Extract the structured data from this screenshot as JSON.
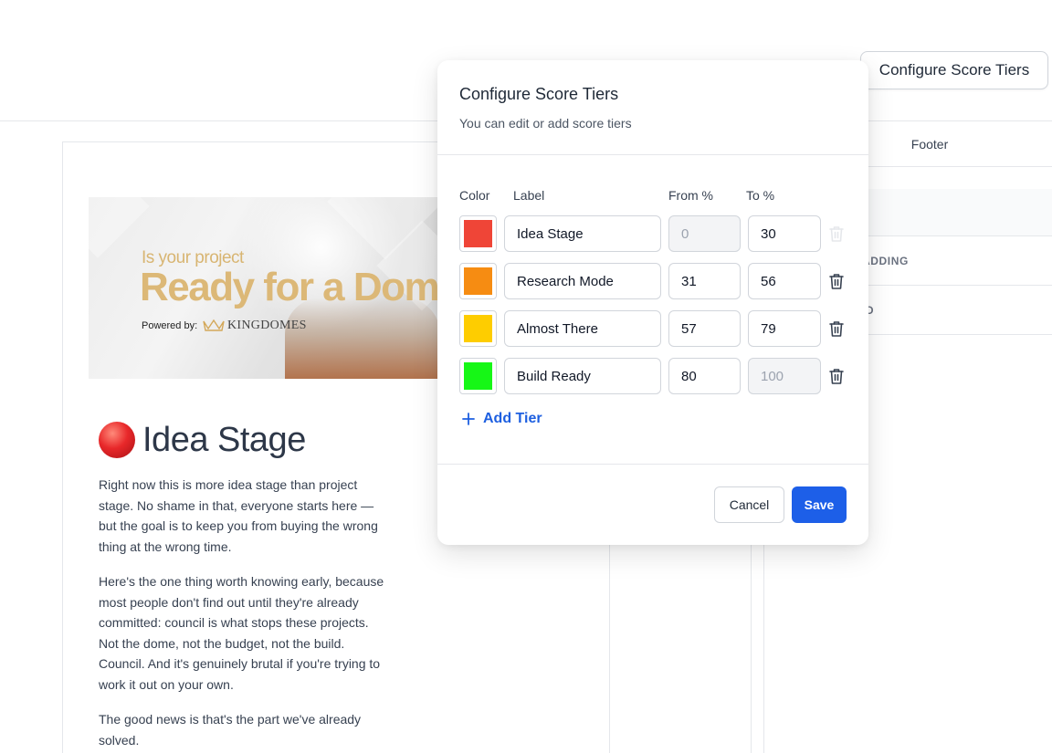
{
  "toolbar": {
    "configure_button_label": "Configure Score Tiers"
  },
  "right_panel": {
    "footer_tab": "Footer",
    "rows": [
      "ADDING",
      "ID"
    ]
  },
  "hero": {
    "line_small": "Is your project",
    "line_big": "Ready for a Dom",
    "powered_by": "Powered by:",
    "brand": "KINGDOMES"
  },
  "result": {
    "emoji": "red-circle-icon",
    "title": "Idea Stage",
    "paragraphs": [
      "Right now this is more idea stage than project stage. No shame in that, everyone starts here — but the goal is to keep you from buying the wrong thing at the wrong time.",
      "Here's the one thing worth knowing early, because most people don't find out until they're already committed: council is what stops these projects. Not the dome, not the budget, not the build. Council. And it's genuinely brutal if you're trying to work it out on your own.",
      "The good news is that's the part we've already solved."
    ]
  },
  "modal": {
    "title": "Configure Score Tiers",
    "subtitle": "You can edit or add score tiers",
    "columns": {
      "color": "Color",
      "label": "Label",
      "from": "From %",
      "to": "To %"
    },
    "tiers": [
      {
        "color": "#ef4537",
        "label": "Idea Stage",
        "from": "0",
        "to": "30",
        "from_disabled": true,
        "to_disabled": false,
        "deletable": false
      },
      {
        "color": "#f68c12",
        "label": "Research Mode",
        "from": "31",
        "to": "56",
        "from_disabled": false,
        "to_disabled": false,
        "deletable": true
      },
      {
        "color": "#fecd00",
        "label": "Almost There",
        "from": "57",
        "to": "79",
        "from_disabled": false,
        "to_disabled": false,
        "deletable": true
      },
      {
        "color": "#16f716",
        "label": "Build Ready",
        "from": "80",
        "to": "100",
        "from_disabled": false,
        "to_disabled": true,
        "deletable": true
      }
    ],
    "add_tier_label": "Add Tier",
    "cancel_label": "Cancel",
    "save_label": "Save"
  },
  "colors": {
    "accent": "#1d5fe8",
    "link": "#1d5fe0"
  }
}
